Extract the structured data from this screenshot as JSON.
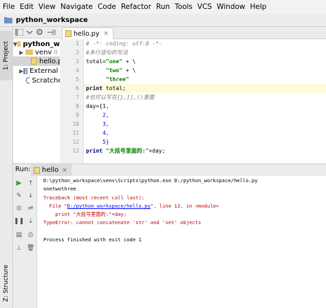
{
  "menu": [
    "File",
    "Edit",
    "View",
    "Navigate",
    "Code",
    "Refactor",
    "Run",
    "Tools",
    "VCS",
    "Window",
    "Help"
  ],
  "project_bar": {
    "title": "python_workspace"
  },
  "left_strip": {
    "project_tab": "1: Project",
    "structure_tab": "Z: Structure"
  },
  "tree": {
    "root": "python_w",
    "venv": "venv",
    "venv_suffix": "li",
    "file": "hello.py",
    "external": "External Li",
    "scratches": "Scratches a"
  },
  "editor": {
    "tab_label": "hello.py",
    "line_numbers": [
      "1",
      "2",
      "3",
      "4",
      "5",
      "6",
      "7",
      "8",
      "9",
      "10",
      "11",
      "12",
      "13"
    ]
  },
  "code": {
    "l1": "# -*- coding: utf-8 -*-",
    "l2": "#多行语句的写法",
    "l3a": "total=",
    "l3b": "\"one\"",
    "l3c": " + \\",
    "l4a": "      ",
    "l4b": "\"two\"",
    "l4c": " + \\",
    "l5a": "      ",
    "l5b": "\"three\"",
    "l6a": "print",
    "l6b": " total;",
    "l7": "#也可以写在{},[],()里面",
    "l8": "day={1,",
    "l9": "     2,",
    "l10": "     3,",
    "l11": "     4,",
    "l12": "     5}",
    "l13a": "print ",
    "l13b": "\"大括号里面的:\"",
    "l13c": "+day;"
  },
  "run": {
    "label": "Run:",
    "tab": "hello",
    "output": {
      "cmd": "D:\\python_workspace\\venv\\Scripts\\python.exe D:/python_workspace/hello.py",
      "out1": "onetwothree",
      "tb": "Traceback (most recent call last):",
      "file_pre": "  File \"",
      "file_link": "D:/python_workspace/hello.py",
      "file_post": "\", line 13, in <module>",
      "err_line": "    print \"大括号里面的:\"+day;",
      "type_err": "TypeError: cannot concatenate 'str' and 'set' objects",
      "finish": "Process finished with exit code 1"
    }
  }
}
